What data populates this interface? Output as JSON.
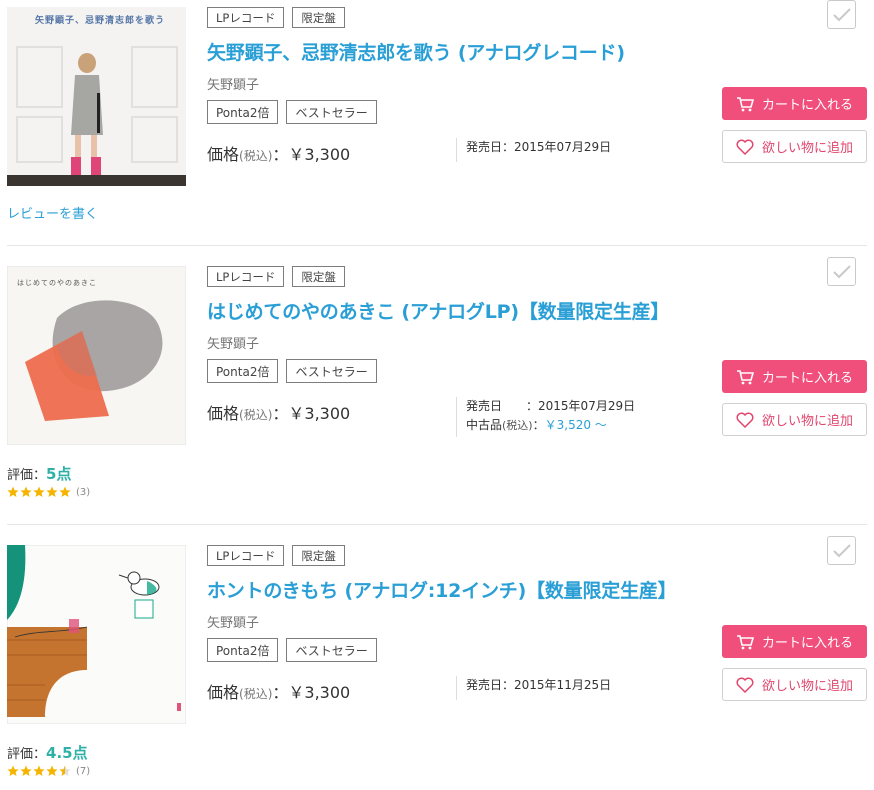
{
  "icons": {
    "cart": "shopping-cart-icon",
    "heart": "heart-icon",
    "check": "checkmark-icon",
    "star": "star-icon"
  },
  "colors": {
    "accent": "#2a9fd6",
    "cart_button": "#f04f7c",
    "rating": "#2fb0a7",
    "star": "#f5b400"
  },
  "items": [
    {
      "cover_text": "矢野顕子、忌野清志郎を歌う",
      "tags": [
        "LPレコード",
        "限定盤"
      ],
      "title": "矢野顕子、忌野清志郎を歌う (アナログレコード)",
      "artist": "矢野顕子",
      "badges": [
        "Ponta2倍",
        "ベストセラー"
      ],
      "price_label": "価格",
      "price_tax": "(税込)",
      "price_value": "：￥3,300",
      "release_label": "発売日：",
      "release_date": "2015年07月29日",
      "cart_label": "カートに入れる",
      "wish_label": "欲しい物に追加",
      "review_link": "レビューを書く"
    },
    {
      "cover_text": "はじめてのやのあきこ",
      "tags": [
        "LPレコード",
        "限定盤"
      ],
      "title": "はじめてのやのあきこ (アナログLP)【数量限定生産】",
      "artist": "矢野顕子",
      "badges": [
        "Ponta2倍",
        "ベストセラー"
      ],
      "price_label": "価格",
      "price_tax": "(税込)",
      "price_value": "：￥3,300",
      "release_label": "発売日　　：",
      "release_date": "2015年07月29日",
      "used_label": "中古品",
      "used_tax": "(税込)",
      "used_colon": "：",
      "used_price": "￥3,520 ～",
      "cart_label": "カートに入れる",
      "wish_label": "欲しい物に追加",
      "rating_label": "評価：",
      "rating_score": "5点",
      "rating_stars": 5,
      "rating_count": "(3)"
    },
    {
      "tags": [
        "LPレコード",
        "限定盤"
      ],
      "title": "ホントのきもち (アナログ:12インチ)【数量限定生産】",
      "artist": "矢野顕子",
      "badges": [
        "Ponta2倍",
        "ベストセラー"
      ],
      "price_label": "価格",
      "price_tax": "(税込)",
      "price_value": "：￥3,300",
      "release_label": "発売日：",
      "release_date": "2015年11月25日",
      "cart_label": "カートに入れる",
      "wish_label": "欲しい物に追加",
      "rating_label": "評価：",
      "rating_score": "4.5点",
      "rating_stars": 4.5,
      "rating_count": "(7)"
    }
  ]
}
